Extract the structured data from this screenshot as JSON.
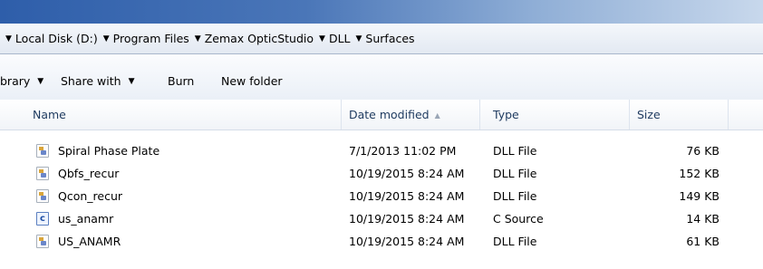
{
  "breadcrumbs": [
    "Local Disk (D:)",
    "Program Files",
    "Zemax OpticStudio",
    "DLL",
    "Surfaces"
  ],
  "toolbar": {
    "library_label": "brary",
    "share_label": "Share with",
    "burn_label": "Burn",
    "new_folder_label": "New folder"
  },
  "columns": {
    "name": "Name",
    "date": "Date modified",
    "type": "Type",
    "size": "Size"
  },
  "files": [
    {
      "name": "Spiral Phase Plate",
      "date": "7/1/2013 11:02 PM",
      "type": "DLL File",
      "size": "76 KB",
      "icon": "dll-file-icon"
    },
    {
      "name": "Qbfs_recur",
      "date": "10/19/2015 8:24 AM",
      "type": "DLL File",
      "size": "152 KB",
      "icon": "dll-file-icon"
    },
    {
      "name": "Qcon_recur",
      "date": "10/19/2015 8:24 AM",
      "type": "DLL File",
      "size": "149 KB",
      "icon": "dll-file-icon"
    },
    {
      "name": "us_anamr",
      "date": "10/19/2015 8:24 AM",
      "type": "C Source",
      "size": "14 KB",
      "icon": "c-source-icon"
    },
    {
      "name": "US_ANAMR",
      "date": "10/19/2015 8:24 AM",
      "type": "DLL File",
      "size": "61 KB",
      "icon": "dll-file-icon"
    }
  ]
}
